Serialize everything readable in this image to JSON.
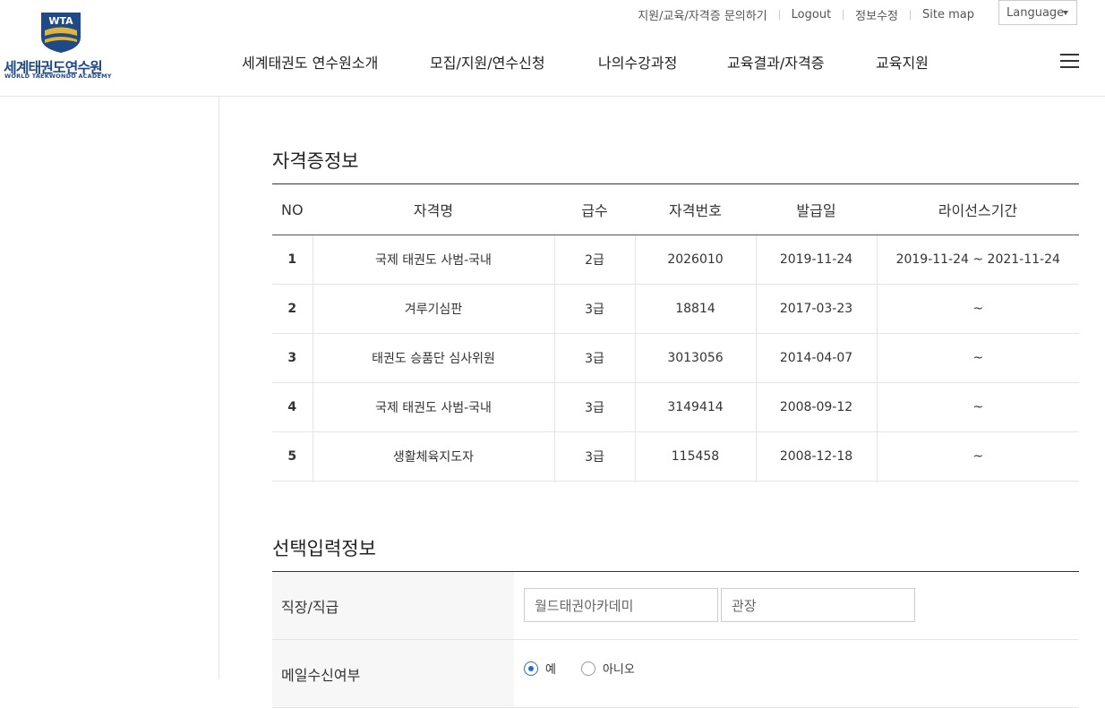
{
  "logo": {
    "emblem_text": "WTA",
    "name_ko": "세계태권도연수원",
    "name_en": "WORLD TAEKWONDO ACADEMY"
  },
  "util": {
    "links": [
      "지원/교육/자격증 문의하기",
      "Logout",
      "정보수정",
      "Site map"
    ],
    "language": "Language"
  },
  "nav": {
    "items": [
      "세계태권도 연수원소개",
      "모집/지원/연수신청",
      "나의수강과정",
      "교육결과/자격증",
      "교육지원"
    ]
  },
  "cert": {
    "title": "자격증정보",
    "headers": [
      "NO",
      "자격명",
      "급수",
      "자격번호",
      "발급일",
      "라이선스기간"
    ],
    "rows": [
      [
        "1",
        "국제 태권도 사범-국내",
        "2급",
        "2026010",
        "2019-11-24",
        "2019-11-24 ~ 2021-11-24"
      ],
      [
        "2",
        "겨루기심판",
        "3급",
        "18814",
        "2017-03-23",
        "~"
      ],
      [
        "3",
        "태권도 승품단 심사위원",
        "3급",
        "3013056",
        "2014-04-07",
        "~"
      ],
      [
        "4",
        "국제 태권도 사범-국내",
        "3급",
        "3149414",
        "2008-09-12",
        "~"
      ],
      [
        "5",
        "생활체육지도자",
        "3급",
        "115458",
        "2008-12-18",
        "~"
      ]
    ]
  },
  "optional": {
    "title": "선택입력정보",
    "workplace": {
      "label": "직장/직급",
      "company_value": "월드태권아카데미",
      "position_value": "관장"
    },
    "email": {
      "label": "메일수신여부",
      "options": [
        "예",
        "아니오"
      ],
      "selected": "예"
    }
  },
  "colors": {
    "brand": "#1f4a86",
    "radio_accent": "#2a6ebb"
  }
}
